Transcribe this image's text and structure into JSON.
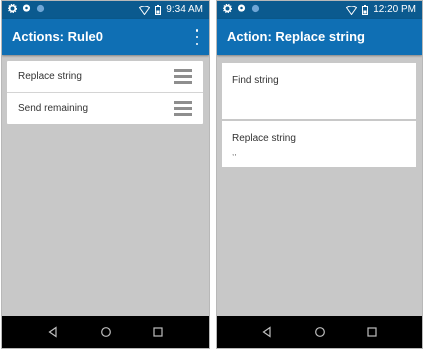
{
  "left_screen": {
    "status": {
      "time": "9:34 AM"
    },
    "title": "Actions: Rule0",
    "items": [
      {
        "label": "Replace string"
      },
      {
        "label": "Send remaining"
      }
    ]
  },
  "right_screen": {
    "status": {
      "time": "12:20 PM"
    },
    "title": "Action: Replace string",
    "fields": [
      {
        "label": "Find string",
        "value": ""
      },
      {
        "label": "Replace string",
        "value": ",,"
      }
    ]
  },
  "status_icons": [
    "settings-icon",
    "messenger-icon",
    "circle-icon",
    "wifi-icon",
    "battery-icon"
  ],
  "nav_icons": [
    "back-icon",
    "home-icon",
    "recents-icon"
  ],
  "colors": {
    "app_bar": "#0f6fb4",
    "status_bar": "#0b5a8f",
    "background": "#c8c8c8",
    "nav_bar": "#000000"
  }
}
